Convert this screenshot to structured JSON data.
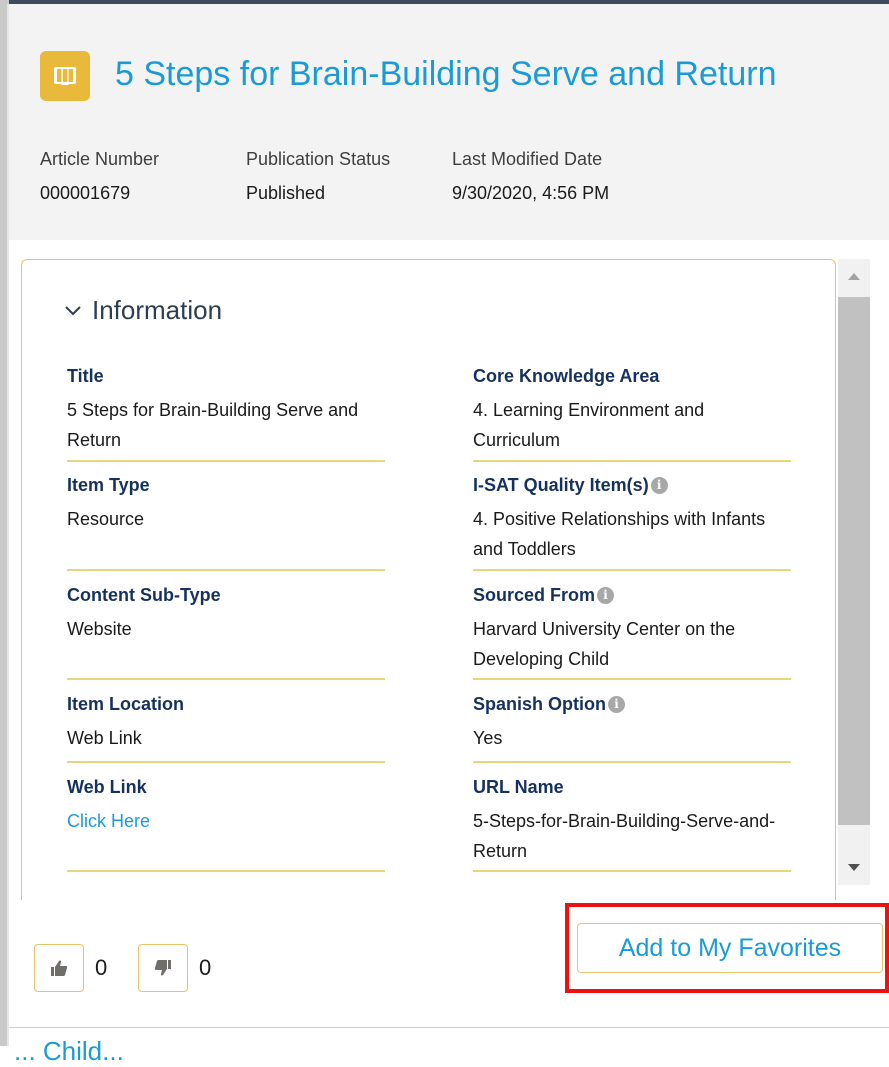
{
  "article": {
    "title": "5 Steps for Brain-Building Serve and Return",
    "icon": "knowledge-book-icon",
    "meta": [
      {
        "label": "Article Number",
        "value": "000001679"
      },
      {
        "label": "Publication Status",
        "value": "Published"
      },
      {
        "label": "Last Modified Date",
        "value": "9/30/2020, 4:56 PM"
      }
    ]
  },
  "information": {
    "section_label": "Information",
    "left_fields": [
      {
        "label": "Title",
        "value": "5 Steps for Brain-Building Serve and Return"
      },
      {
        "label": "Item Type",
        "value": "Resource"
      },
      {
        "label": "Content Sub-Type",
        "value": "Website"
      },
      {
        "label": "Item Location",
        "value": "Web Link"
      },
      {
        "label": "Web Link",
        "value": "Click Here"
      }
    ],
    "right_fields": [
      {
        "label": "Core Knowledge Area",
        "value": "4. Learning Environment and Curriculum"
      },
      {
        "label": "I-SAT Quality Item(s)",
        "value": "4. Positive Relationships with Infants and Toddlers"
      },
      {
        "label": "Sourced From",
        "value": "Harvard University Center on the Developing Child"
      },
      {
        "label": "Spanish Option",
        "value": "Yes"
      },
      {
        "label": "URL Name",
        "value": "5-Steps-for-Brain-Building-Serve-and-Return"
      }
    ]
  },
  "votes": {
    "up_count": "0",
    "down_count": "0"
  },
  "actions": {
    "favorites_label": "Add to My Favorites"
  },
  "cutoff_text": "... Child..."
}
